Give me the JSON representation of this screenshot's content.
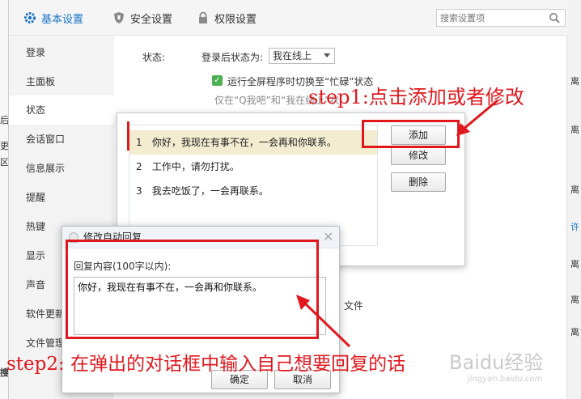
{
  "top_tabs": {
    "basic": "基本设置",
    "security": "安全设置",
    "permission": "权限设置"
  },
  "search": {
    "placeholder": "搜索设置项"
  },
  "sidebar": {
    "items": [
      {
        "label": "登录"
      },
      {
        "label": "主面板"
      },
      {
        "label": "状态"
      },
      {
        "label": "会话窗口"
      },
      {
        "label": "信息展示"
      },
      {
        "label": "提醒"
      },
      {
        "label": "热键"
      },
      {
        "label": "显示"
      },
      {
        "label": "声音"
      },
      {
        "label": "软件更新"
      },
      {
        "label": "文件管理"
      }
    ],
    "active_index": 2
  },
  "status_section": {
    "label": "状态:",
    "after_login_label": "登录后状态为:",
    "after_login_value": "我在线上",
    "fullscreen_text": "运行全屏程序时切换至“忙碌”状态",
    "partial_text": "仅在“Q我吧”和“我在线上”状",
    "file_fragment": "文件"
  },
  "reply_dialog": {
    "items": [
      {
        "num": "1",
        "text": "你好，我现在有事不在，一会再和你联系。"
      },
      {
        "num": "2",
        "text": "工作中，请勿打扰。"
      },
      {
        "num": "3",
        "text": "我去吃饭了，一会再联系。"
      }
    ],
    "buttons": {
      "add": "添加",
      "modify": "修改",
      "delete": "删除"
    }
  },
  "edit_dialog": {
    "title": "修改自动回复",
    "content_label": "回复内容(100字以内):",
    "content_value": "你好，我现在有事不在，一会再和你联系。",
    "ok": "确定",
    "cancel": "取消"
  },
  "annotations": {
    "step1": "step1:点击添加或者修改",
    "step2": "step2: 在弹出的对话框中输入自己想要回复的话",
    "color": "#e0181e"
  },
  "edge_text": {
    "left_chars": [
      "后",
      "更",
      "区",
      "搜"
    ],
    "right_chars": [
      "离",
      "离",
      "离",
      "许",
      "离",
      "离",
      "离"
    ]
  },
  "watermark": {
    "brand": "Baidu经验",
    "url": "jingyan.baidu.com"
  }
}
